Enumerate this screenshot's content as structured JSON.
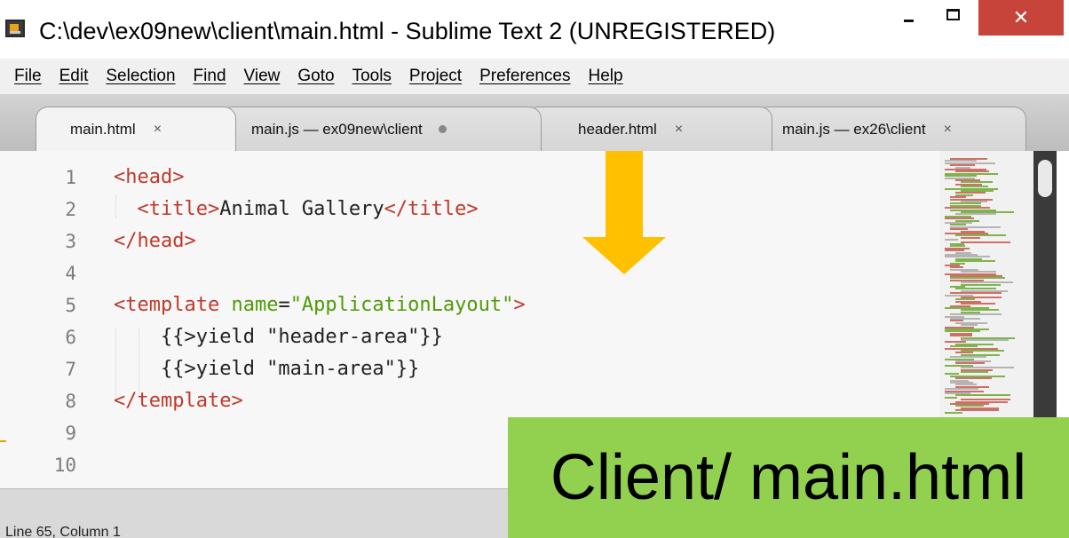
{
  "window": {
    "title": "C:\\dev\\ex09new\\client\\main.html - Sublime Text 2 (UNREGISTERED)",
    "app_icon": "sublime-text-icon",
    "controls": {
      "minimize_icon": "minimize-icon",
      "maximize_icon": "maximize-icon",
      "close_label": "✕"
    }
  },
  "menu": {
    "items": [
      "File",
      "Edit",
      "Selection",
      "Find",
      "View",
      "Goto",
      "Tools",
      "Project",
      "Preferences",
      "Help"
    ]
  },
  "tabs": [
    {
      "label": "main.html",
      "state": "active",
      "close": "×"
    },
    {
      "label": "main.js — ex09new\\client",
      "state": "modified"
    },
    {
      "label": "header.html",
      "state": "normal",
      "close": "×"
    },
    {
      "label": "main.js — ex26\\client",
      "state": "normal",
      "close": "×"
    }
  ],
  "editor": {
    "line_numbers": [
      "1",
      "2",
      "3",
      "4",
      "5",
      "6",
      "7",
      "8",
      "9",
      "10"
    ],
    "lines": [
      [
        {
          "t": "<head>",
          "c": "tag"
        }
      ],
      [
        {
          "t": "  <title>",
          "c": "tag"
        },
        {
          "t": "Animal Gallery",
          "c": "plain"
        },
        {
          "t": "</title>",
          "c": "tag"
        }
      ],
      [
        {
          "t": "</head>",
          "c": "tag"
        }
      ],
      [],
      [
        {
          "t": "<template ",
          "c": "tag"
        },
        {
          "t": "name",
          "c": "attr"
        },
        {
          "t": "=",
          "c": "plain"
        },
        {
          "t": "\"ApplicationLayout\"",
          "c": "str"
        },
        {
          "t": ">",
          "c": "tag"
        }
      ],
      [
        {
          "t": "    {{>yield \"header-area\"}}",
          "c": "plain"
        }
      ],
      [
        {
          "t": "    {{>yield \"main-area\"}}",
          "c": "plain"
        }
      ],
      [
        {
          "t": "</template>",
          "c": "tag"
        }
      ],
      [],
      []
    ],
    "colors": {
      "tag": "#c0392b",
      "attr": "#4e9a06",
      "string": "#4e9a06",
      "text": "#222222"
    }
  },
  "status": {
    "position": "Line 65, Column 1"
  },
  "overlay": {
    "arrow_color": "#ffc000",
    "callout_text": "Client/ main.html",
    "callout_color": "#92d050"
  }
}
